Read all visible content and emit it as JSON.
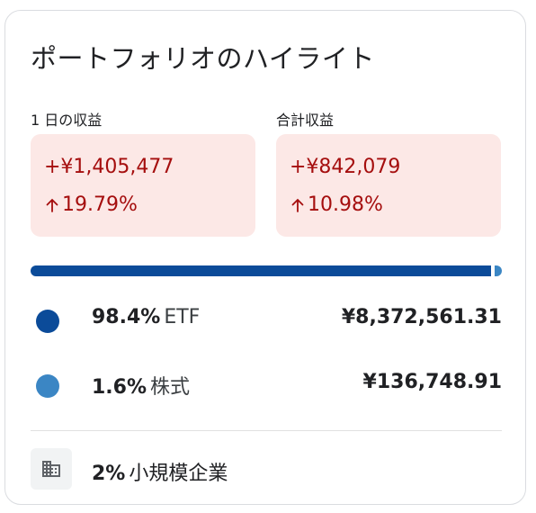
{
  "header": {
    "title": "ポートフォリオのハイライト"
  },
  "daily": {
    "label": "1 日の収益",
    "amount": "+¥1,405,477",
    "percent": "19.79%",
    "direction": "up"
  },
  "total": {
    "label": "合計収益",
    "amount": "+¥842,079",
    "percent": "10.98%",
    "direction": "up"
  },
  "allocation": {
    "items": [
      {
        "percent": "98.4%",
        "share": 0.984,
        "name": "ETF",
        "value": "¥8,372,561.31",
        "color": "#0b4b99"
      },
      {
        "percent": "1.6%",
        "share": 0.016,
        "name": "株式",
        "value": "¥136,748.91",
        "color": "#3b86c4"
      }
    ]
  },
  "category": {
    "percent": "2%",
    "name": "小規模企業",
    "icon": "building-icon"
  },
  "colors": {
    "gain_text": "#a50e0e",
    "gain_bg": "#fce8e6"
  }
}
